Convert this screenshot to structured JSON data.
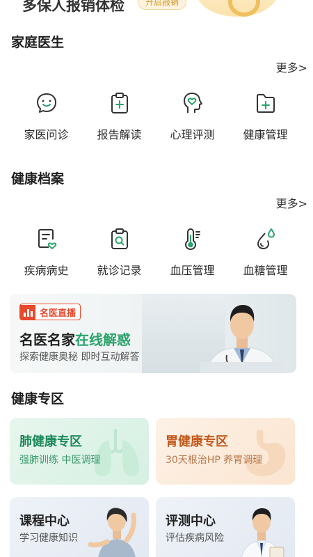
{
  "promo": {
    "text": "多保人报销体检",
    "pill": "开启报销"
  },
  "family_doctor": {
    "title": "家庭医生",
    "more": "更多>",
    "items": [
      {
        "label": "家医问诊",
        "icon": "chat-smile-icon"
      },
      {
        "label": "报告解读",
        "icon": "clipboard-plus-icon"
      },
      {
        "label": "心理评测",
        "icon": "head-heart-icon"
      },
      {
        "label": "健康管理",
        "icon": "folder-plus-icon"
      }
    ]
  },
  "health_records": {
    "title": "健康档案",
    "more": "更多>",
    "items": [
      {
        "label": "疾病病史",
        "icon": "document-heart-icon"
      },
      {
        "label": "就诊记录",
        "icon": "clipboard-search-icon"
      },
      {
        "label": "血压管理",
        "icon": "thermometer-icon"
      },
      {
        "label": "血糖管理",
        "icon": "blood-drop-icon"
      }
    ]
  },
  "live_banner": {
    "badge": "名医直播",
    "title_main": "名医名家",
    "title_accent": "在线解惑",
    "subtitle": "探索健康奥秘 即时互动解答"
  },
  "health_zone": {
    "title": "健康专区",
    "cards": [
      {
        "title": "肺健康专区",
        "subtitle": "强肺训练 中医调理"
      },
      {
        "title": "胃健康专区",
        "subtitle": "30天根治HP 养胃调理"
      },
      {
        "title": "课程中心",
        "subtitle": "学习健康知识"
      },
      {
        "title": "评测中心",
        "subtitle": "评估疾病风险"
      }
    ]
  },
  "colors": {
    "accent_green": "#2aa36b",
    "icon_dark": "#333333",
    "live_red": "#e8492d",
    "lung_title": "#1d8a5a",
    "stomach_title": "#c25a1c"
  }
}
